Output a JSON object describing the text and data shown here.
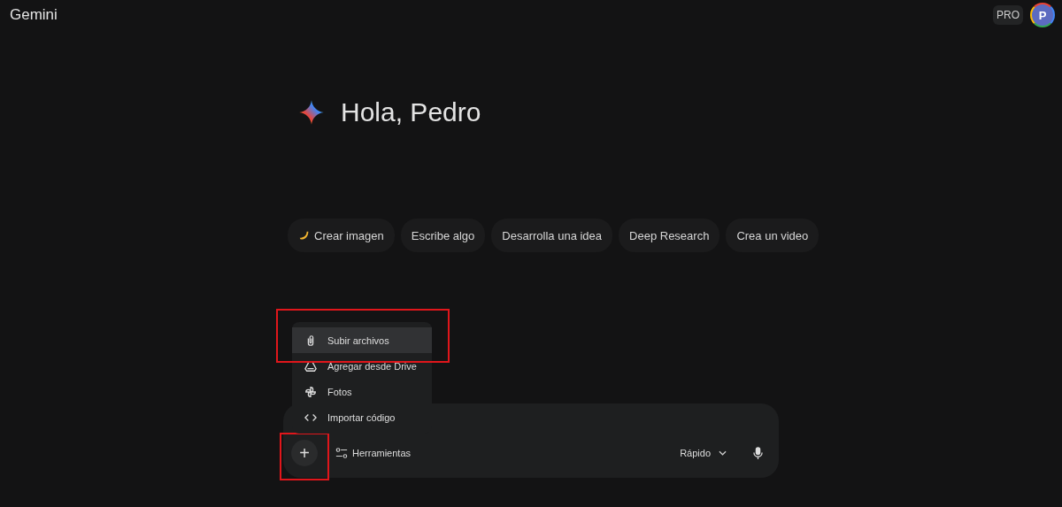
{
  "app_title": "Gemini",
  "account": {
    "plan_badge": "PRO",
    "avatar_initial": "P"
  },
  "greeting": "Hola, Pedro",
  "suggestions": [
    {
      "label": "Crear imagen",
      "kind": "banana"
    },
    {
      "label": "Escribe algo",
      "kind": "plain"
    },
    {
      "label": "Desarrolla una idea",
      "kind": "plain"
    },
    {
      "label": "Deep Research",
      "kind": "plain"
    },
    {
      "label": "Crea un video",
      "kind": "plain"
    }
  ],
  "upload_menu": [
    {
      "label": "Subir archivos",
      "kind": "clip",
      "selected": true,
      "highlighted": true
    },
    {
      "label": "Agregar desde Drive",
      "kind": "drive",
      "selected": false,
      "highlighted": false
    },
    {
      "label": "Fotos",
      "kind": "photos",
      "selected": false,
      "highlighted": false
    },
    {
      "label": "Importar código",
      "kind": "code",
      "selected": false,
      "highlighted": false
    }
  ],
  "composer": {
    "add_button": {
      "symbol": "+",
      "highlighted": true
    },
    "tools_label": "Herramientas",
    "model_label": "Rápido"
  }
}
